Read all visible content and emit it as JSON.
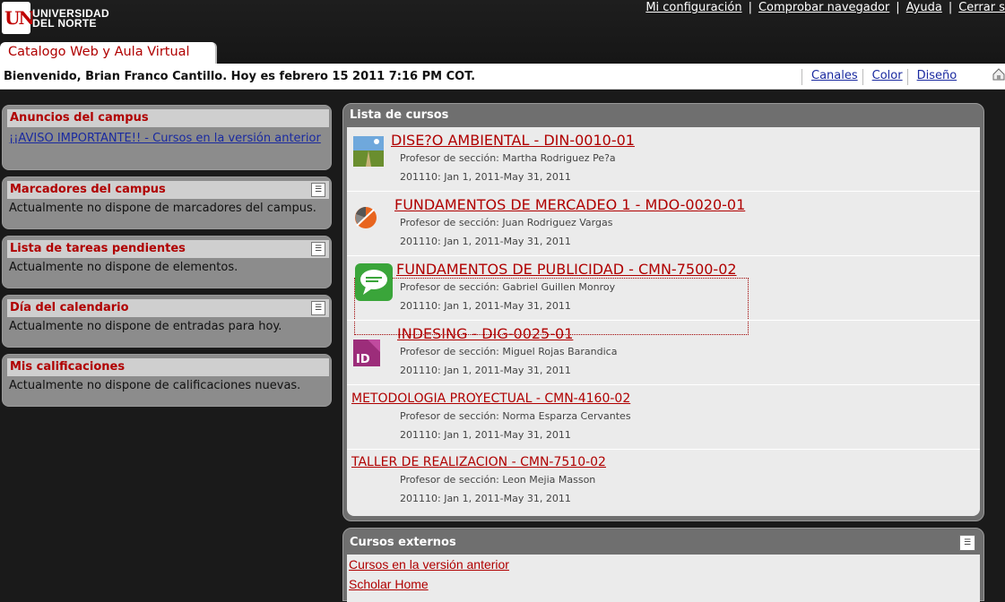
{
  "header": {
    "logo_text": "UN",
    "logo_name_line1": "UNIVERSIDAD",
    "logo_name_line2": "DEL NORTE",
    "links": [
      "Mi configuración",
      "Comprobar navegador",
      "Ayuda",
      "Cerrar s"
    ],
    "separator": "|",
    "tab_label": "Catalogo Web y Aula Virtual"
  },
  "welcome": {
    "message": "Bienvenido, Brian Franco Cantillo. Hoy es febrero 15 2011 7:16 PM COT.",
    "links": [
      "Canales",
      "Color",
      "Diseño"
    ],
    "home_icon": "home-icon"
  },
  "modules": [
    {
      "title": "Anuncios del campus",
      "link": "¡¡AVISO IMPORTANTE!! - Cursos en la versión anterior"
    },
    {
      "title": "Marcadores del campus",
      "body": "Actualmente no dispone de marcadores del campus."
    },
    {
      "title": "Lista de tareas pendientes",
      "body": "Actualmente no dispone de elementos."
    },
    {
      "title": "Día del calendario",
      "body": "Actualmente no dispone de entradas para hoy."
    },
    {
      "title": "Mis calificaciones",
      "body": "Actualmente no dispone de calificaciones nuevas."
    }
  ],
  "courses": {
    "title": "Lista de cursos",
    "items": [
      {
        "title": "DISE?O AMBIENTAL - DIN-0010-01",
        "prof": "Profesor de sección: Martha Rodriguez Pe?a",
        "date": "201110: Jan 1, 2011-May 31, 2011",
        "icon": "landscape-icon"
      },
      {
        "title": "FUNDAMENTOS DE MERCADEO 1 - MDO-0020-01",
        "prof": "Profesor de sección: Juan Rodriguez Vargas",
        "date": "201110: Jan 1, 2011-May 31, 2011",
        "icon": "pie-chart-icon"
      },
      {
        "title": "FUNDAMENTOS DE PUBLICIDAD - CMN-7500-02",
        "prof": "Profesor de sección: Gabriel Guillen Monroy",
        "date": "201110: Jan 1, 2011-May 31, 2011",
        "icon": "speech-bubble-icon"
      },
      {
        "title": "INDESING - DIG-0025-01",
        "prof": "Profesor de sección: Miguel Rojas Barandica",
        "date": "201110: Jan 1, 2011-May 31, 2011",
        "icon": "indesign-icon"
      },
      {
        "title": "METODOLOGIA PROYECTUAL - CMN-4160-02",
        "prof": "Profesor de sección: Norma Esparza Cervantes",
        "date": "201110: Jan 1, 2011-May 31, 2011"
      },
      {
        "title": "TALLER DE REALIZACION - CMN-7510-02",
        "prof": "Profesor de sección: Leon Mejia Masson",
        "date": "201110: Jan 1, 2011-May 31, 2011"
      }
    ]
  },
  "external": {
    "title": "Cursos externos",
    "links": [
      "Cursos en la versión anterior",
      "Scholar Home"
    ]
  }
}
